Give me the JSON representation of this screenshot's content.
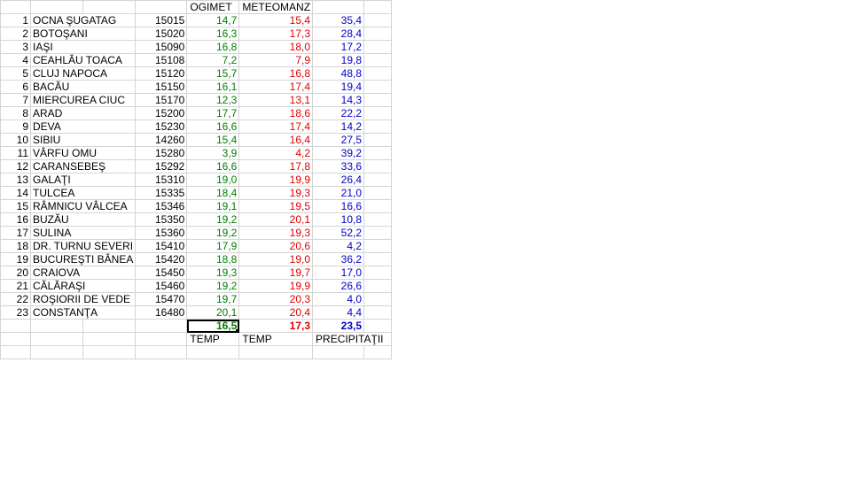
{
  "headers": {
    "ogimet": "OGIMET",
    "meteomanz": "METEOMANZ"
  },
  "rows": [
    {
      "n": "1",
      "name": "OCNA ŞUGATAG",
      "code": "15015",
      "og": "14,7",
      "mm": "15,4",
      "pr": "35,4"
    },
    {
      "n": "2",
      "name": "BOTOŞANI",
      "code": "15020",
      "og": "16,3",
      "mm": "17,3",
      "pr": "28,4"
    },
    {
      "n": "3",
      "name": "IAŞI",
      "code": "15090",
      "og": "16,8",
      "mm": "18,0",
      "pr": "17,2"
    },
    {
      "n": "4",
      "name": "CEAHLĂU TOACA",
      "code": "15108",
      "og": "7,2",
      "mm": "7,9",
      "pr": "19,8"
    },
    {
      "n": "5",
      "name": "CLUJ NAPOCA",
      "code": "15120",
      "og": "15,7",
      "mm": "16,8",
      "pr": "48,8"
    },
    {
      "n": "6",
      "name": "BACĂU",
      "code": "15150",
      "og": "16,1",
      "mm": "17,4",
      "pr": "19,4"
    },
    {
      "n": "7",
      "name": "MIERCUREA CIUC",
      "code": "15170",
      "og": "12,3",
      "mm": "13,1",
      "pr": "14,3"
    },
    {
      "n": "8",
      "name": "ARAD",
      "code": "15200",
      "og": "17,7",
      "mm": "18,6",
      "pr": "22,2"
    },
    {
      "n": "9",
      "name": "DEVA",
      "code": "15230",
      "og": "16,6",
      "mm": "17,4",
      "pr": "14,2"
    },
    {
      "n": "10",
      "name": "SIBIU",
      "code": "14260",
      "og": "15,4",
      "mm": "16,4",
      "pr": "27,5"
    },
    {
      "n": "11",
      "name": "VÂRFU OMU",
      "code": "15280",
      "og": "3,9",
      "mm": "4,2",
      "pr": "39,2"
    },
    {
      "n": "12",
      "name": "CARANSEBEŞ",
      "code": "15292",
      "og": "16,6",
      "mm": "17,8",
      "pr": "33,6"
    },
    {
      "n": "13",
      "name": "GALAŢI",
      "code": "15310",
      "og": "19,0",
      "mm": "19,9",
      "pr": "26,4"
    },
    {
      "n": "14",
      "name": "TULCEA",
      "code": "15335",
      "og": "18,4",
      "mm": "19,3",
      "pr": "21,0"
    },
    {
      "n": "15",
      "name": "RÂMNICU VÂLCEA",
      "code": "15346",
      "og": "19,1",
      "mm": "19,5",
      "pr": "16,6"
    },
    {
      "n": "16",
      "name": "BUZĂU",
      "code": "15350",
      "og": "19,2",
      "mm": "20,1",
      "pr": "10,8"
    },
    {
      "n": "17",
      "name": "SULINA",
      "code": "15360",
      "og": "19,2",
      "mm": "19,3",
      "pr": "52,2"
    },
    {
      "n": "18",
      "name": "DR. TURNU SEVERI",
      "code": "15410",
      "og": "17,9",
      "mm": "20,6",
      "pr": "4,2"
    },
    {
      "n": "19",
      "name": "BUCUREŞTI BÂNEA",
      "code": "15420",
      "og": "18,8",
      "mm": "19,0",
      "pr": "36,2"
    },
    {
      "n": "20",
      "name": "CRAIOVA",
      "code": "15450",
      "og": "19,3",
      "mm": "19,7",
      "pr": "17,0"
    },
    {
      "n": "21",
      "name": "CĂLĂRAŞI",
      "code": "15460",
      "og": "19,2",
      "mm": "19,9",
      "pr": "26,6"
    },
    {
      "n": "22",
      "name": "ROŞIORII DE VEDE",
      "code": "15470",
      "og": "19,7",
      "mm": "20,3",
      "pr": "4,0"
    },
    {
      "n": "23",
      "name": "CONSTANŢA",
      "code": "16480",
      "og": "20,1",
      "mm": "20,4",
      "pr": "4,4"
    }
  ],
  "totals": {
    "og": "16,5",
    "mm": "17,3",
    "pr": "23,5"
  },
  "footer": {
    "temp1": "TEMP",
    "temp2": "TEMP",
    "precip": "PRECIPITAŢII"
  },
  "colors": {
    "ogimet": "#008000",
    "meteomanz": "#e00000",
    "precip": "#0000cc",
    "gridline": "#d4d4d4"
  }
}
